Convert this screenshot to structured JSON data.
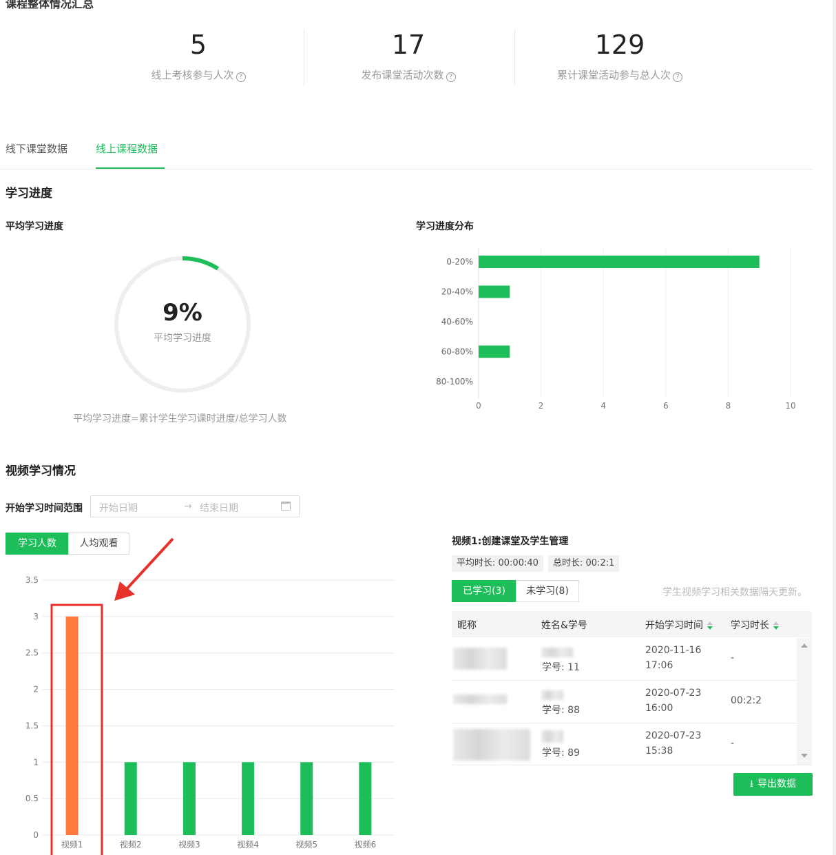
{
  "header": {
    "cut_title": "课程整体情况汇总"
  },
  "stats": [
    {
      "value": "5",
      "label": "线上考核参与人次",
      "help_icon": "question-circle-icon"
    },
    {
      "value": "17",
      "label": "发布课堂活动次数",
      "help_icon": "question-circle-icon"
    },
    {
      "value": "129",
      "label": "累计课堂活动参与总人次",
      "help_icon": "question-circle-icon"
    }
  ],
  "tabs": [
    {
      "label": "线下课堂数据",
      "active": false
    },
    {
      "label": "线上课程数据",
      "active": true
    }
  ],
  "progress_section": {
    "title": "学习进度",
    "avg_title": "平均学习进度",
    "avg_value": "9%",
    "avg_value_fraction": 0.09,
    "avg_caption": "平均学习进度",
    "formula": "平均学习进度=累计学生学习课时进度/总学习人数",
    "dist_title": "学习进度分布"
  },
  "video_section": {
    "title": "视频学习情况",
    "date_range_label": "开始学习时间范围",
    "start_placeholder": "开始日期",
    "end_placeholder": "结束日期",
    "arrow": "→",
    "calendar_icon": "calendar-icon",
    "toggle": [
      {
        "label": "学习人数",
        "active": true
      },
      {
        "label": "人均观看",
        "active": false
      }
    ],
    "detail": {
      "title": "视频1:创建课堂及学生管理",
      "avg_duration": "平均时长: 00:00:40",
      "total_duration": "总时长: 00:2:1",
      "tabs": [
        {
          "label": "已学习(3)",
          "active": true
        },
        {
          "label": "未学习(8)",
          "active": false
        }
      ],
      "note": "学生视频学习相关数据隔天更新。",
      "columns": [
        "昵称",
        "姓名&学号",
        "开始学习时间",
        "学习时长"
      ],
      "rows": [
        {
          "student_id": "学号: 11",
          "start_date": "2020-11-16",
          "start_time": "17:06",
          "duration": "-"
        },
        {
          "student_id": "学号: 88",
          "start_date": "2020-07-23",
          "start_time": "16:00",
          "duration": "00:2:2"
        },
        {
          "student_id": "学号: 89",
          "start_date": "2020-07-23",
          "start_time": "15:38",
          "duration": "-"
        }
      ],
      "export_label": "导出数据",
      "export_icon": "download-icon"
    }
  },
  "colors": {
    "accent": "#1dbd5a",
    "highlight_bar": "#ff7a3d",
    "annotation_red": "#e8312a"
  },
  "chart_data": [
    {
      "type": "bar",
      "orientation": "horizontal",
      "categories": [
        "0-20%",
        "20-40%",
        "40-60%",
        "60-80%",
        "80-100%"
      ],
      "values": [
        9,
        1,
        0,
        1,
        0
      ],
      "xlim": [
        0,
        10
      ],
      "xticks": [
        "0",
        "2",
        "4",
        "6",
        "8",
        "10"
      ],
      "grid": true
    },
    {
      "type": "bar",
      "categories": [
        "视频1",
        "视频2",
        "视频3",
        "视频4",
        "视频5",
        "视频6"
      ],
      "values": [
        3,
        1,
        1,
        1,
        1,
        1
      ],
      "highlighted_category": "视频1",
      "ylim": [
        0,
        3.5
      ],
      "yticks": [
        "0",
        "0.5",
        "1",
        "1.5",
        "2",
        "2.5",
        "3",
        "3.5"
      ],
      "grid": true
    }
  ]
}
